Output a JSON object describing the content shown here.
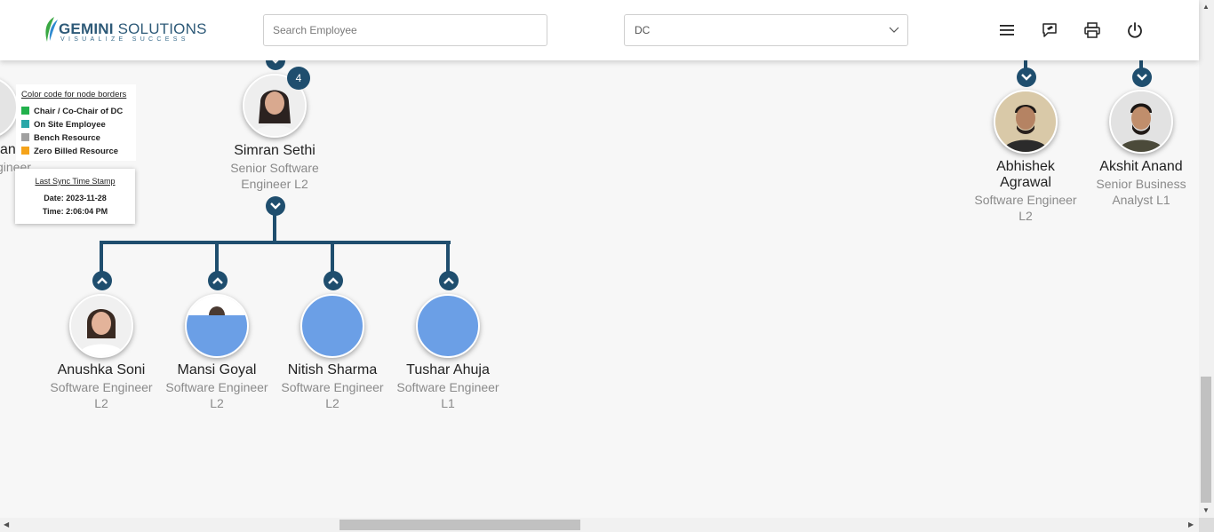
{
  "header": {
    "logo": {
      "brand_bold": "GEMINI",
      "brand_rest": " SOLUTIONS",
      "tagline": "VISUALIZE SUCCESS"
    },
    "search": {
      "placeholder": "Search Employee"
    },
    "department_select": {
      "value": "DC"
    },
    "icons": [
      "menu-icon",
      "feedback-icon",
      "print-icon",
      "power-icon"
    ]
  },
  "legend": {
    "title": "Color code for node borders",
    "items": [
      {
        "label": "Chair / Co-Chair of DC",
        "color": "#22b14c"
      },
      {
        "label": "On Site Employee",
        "color": "#2aa7a8"
      },
      {
        "label": "Bench Resource",
        "color": "#a0a0a0"
      },
      {
        "label": "Zero Billed Resource",
        "color": "#f5a31a"
      }
    ]
  },
  "sync": {
    "title": "Last Sync Time Stamp",
    "date": "Date: 2023-11-28",
    "time": "Time: 2:06:04 PM"
  },
  "partial_node": {
    "name_fragment": "an",
    "role_fragment": "gineer"
  },
  "focus_node": {
    "name": "Simran Sethi",
    "role_line1": "Senior Software",
    "role_line2": "Engineer L2",
    "reports_count": "4"
  },
  "children": [
    {
      "name": "Anushka Soni",
      "role_line1": "Software Engineer",
      "role_line2": "L2"
    },
    {
      "name": "Mansi Goyal",
      "role_line1": "Software Engineer",
      "role_line2": "L2"
    },
    {
      "name": "Nitish Sharma",
      "role_line1": "Software Engineer",
      "role_line2": "L2"
    },
    {
      "name": "Tushar Ahuja",
      "role_line1": "Software Engineer",
      "role_line2": "L1"
    }
  ],
  "right_nodes": [
    {
      "name_line1": "Abhishek",
      "name_line2": "Agrawal",
      "role_line1": "Software Engineer",
      "role_line2": "L2"
    },
    {
      "name_line1": "Akshit Anand",
      "name_line2": "",
      "role_line1": "Senior Business",
      "role_line2": "Analyst L1"
    }
  ],
  "colors": {
    "accent": "#1f4e6e",
    "placeholder_avatar": "#6b9fe6"
  }
}
